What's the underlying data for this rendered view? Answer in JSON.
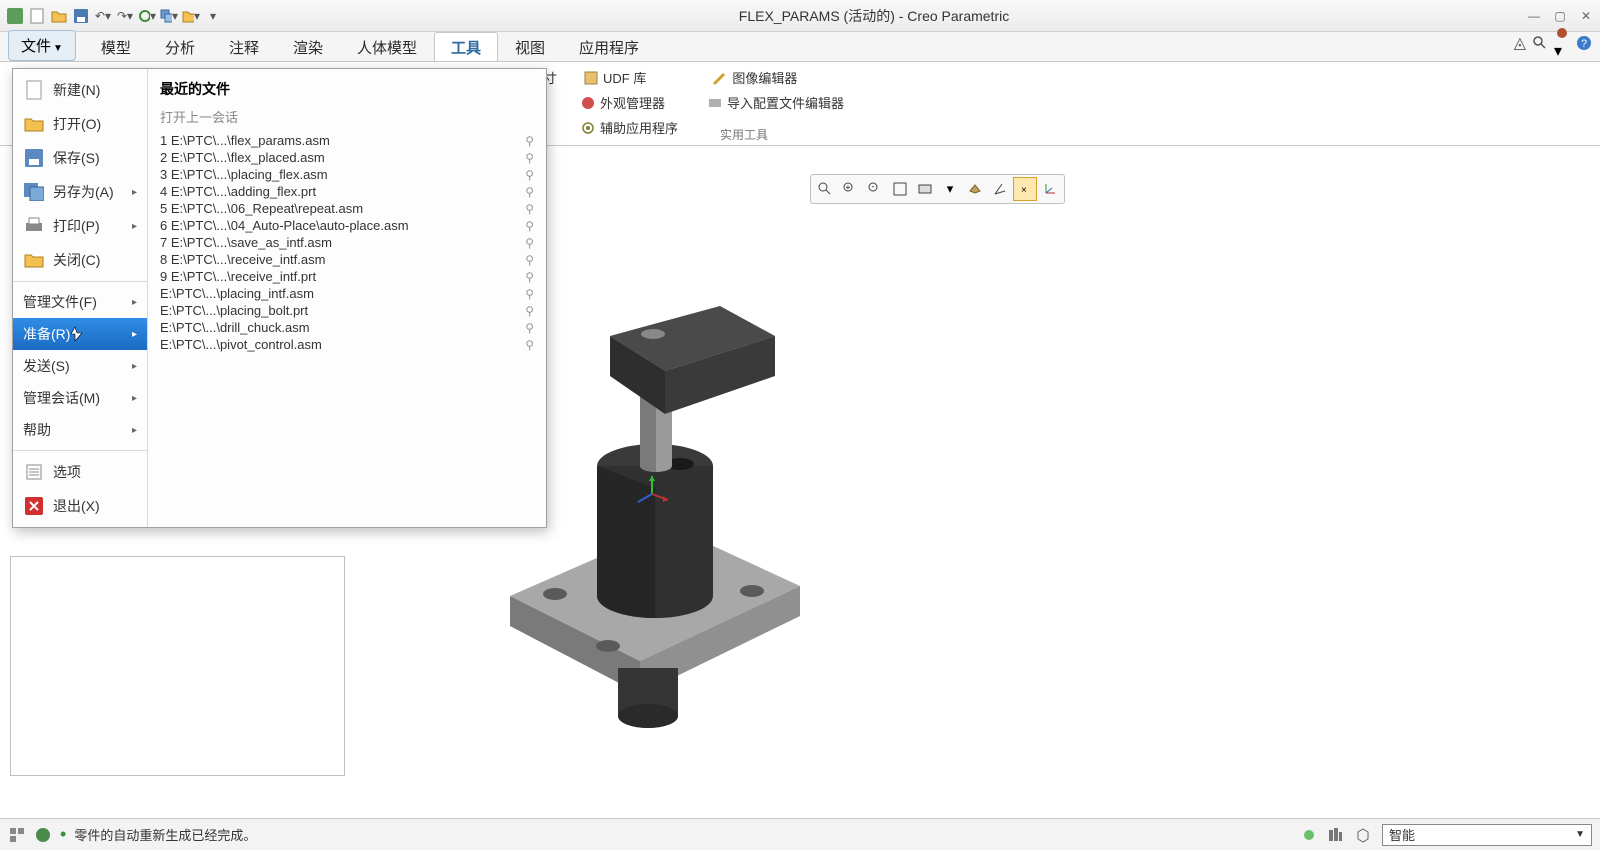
{
  "title": "FLEX_PARAMS (活动的) - Creo Parametric",
  "ribbon_tabs": {
    "file": "文件",
    "items": [
      "模型",
      "分析",
      "注释",
      "渲染",
      "人体模型",
      "工具",
      "视图",
      "应用程序"
    ],
    "active": "工具"
  },
  "ribbon_items": {
    "dim_suffix": "寸",
    "udf_lib": "UDF 库",
    "appearance_mgr": "外观管理器",
    "aux_app": "辅助应用程序",
    "image_editor": "图像编辑器",
    "import_config": "导入配置文件编辑器",
    "group_label": "实用工具"
  },
  "file_menu": {
    "new": "新建(N)",
    "open": "打开(O)",
    "save": "保存(S)",
    "save_as": "另存为(A)",
    "print": "打印(P)",
    "close": "关闭(C)",
    "manage_file": "管理文件(F)",
    "prepare": "准备(R)",
    "send": "发送(S)",
    "manage_session": "管理会话(M)",
    "help": "帮助",
    "options": "选项",
    "exit": "退出(X)"
  },
  "recent": {
    "title": "最近的文件",
    "subtitle": "打开上一会话",
    "files": [
      "1 E:\\PTC\\...\\flex_params.asm",
      "2 E:\\PTC\\...\\flex_placed.asm",
      "3 E:\\PTC\\...\\placing_flex.asm",
      "4 E:\\PTC\\...\\adding_flex.prt",
      "5 E:\\PTC\\...\\06_Repeat\\repeat.asm",
      "6 E:\\PTC\\...\\04_Auto-Place\\auto-place.asm",
      "7 E:\\PTC\\...\\save_as_intf.asm",
      "8 E:\\PTC\\...\\receive_intf.asm",
      "9 E:\\PTC\\...\\receive_intf.prt",
      "  E:\\PTC\\...\\placing_intf.asm",
      "  E:\\PTC\\...\\placing_bolt.prt",
      "  E:\\PTC\\...\\drill_chuck.asm",
      "  E:\\PTC\\...\\pivot_control.asm"
    ]
  },
  "status": {
    "msg": "零件的自动重新生成已经完成。",
    "filter": "智能"
  }
}
